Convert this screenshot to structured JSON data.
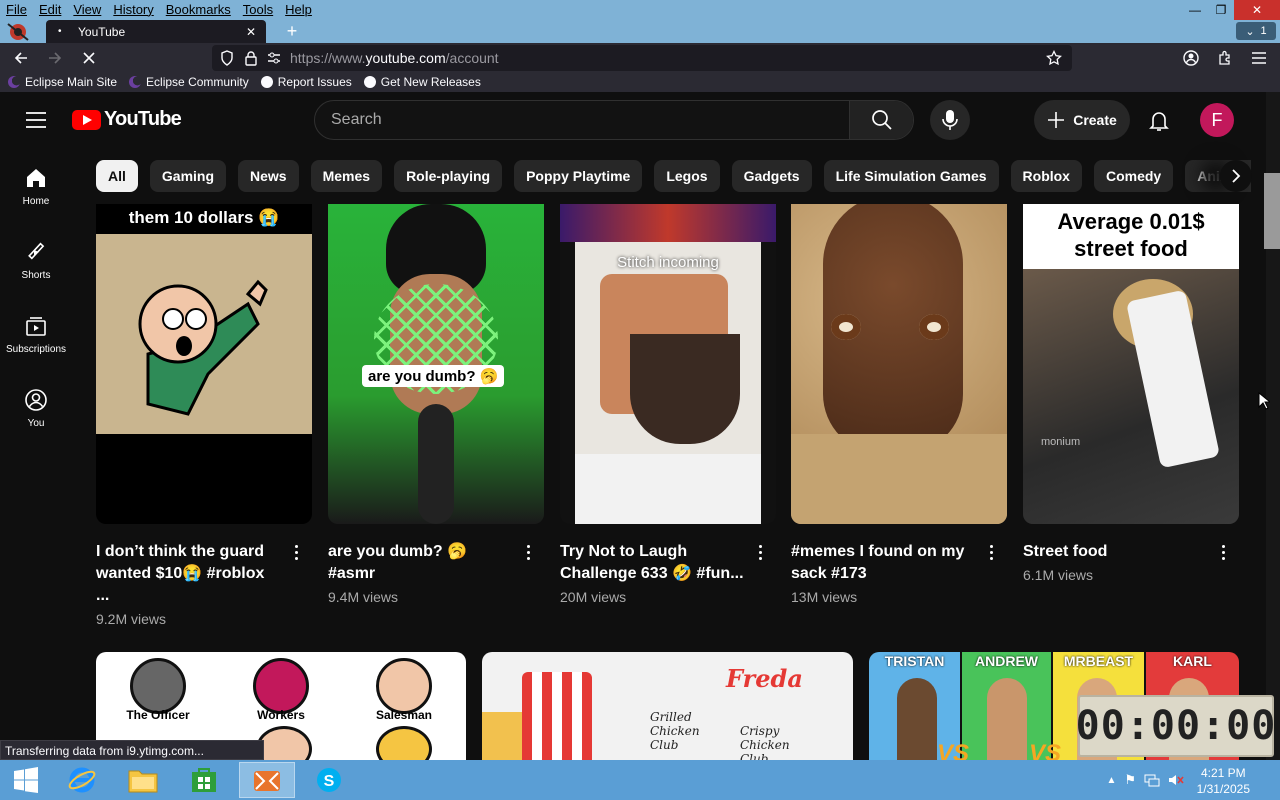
{
  "browser": {
    "menu": [
      "File",
      "Edit",
      "View",
      "History",
      "Bookmarks",
      "Tools",
      "Help"
    ],
    "tab_title": "YouTube",
    "tab_count": "1",
    "url_prefix": "https://www.",
    "url_host": "youtube.com",
    "url_path": "/account",
    "bookmarks": [
      "Eclipse Main Site",
      "Eclipse Community",
      "Report Issues",
      "Get New Releases"
    ],
    "status": "Transferring data from i9.ytimg.com..."
  },
  "youtube": {
    "logo_text": "YouTube",
    "search_placeholder": "Search",
    "create_label": "Create",
    "avatar_letter": "F",
    "sidebar": [
      {
        "label": "Home",
        "icon": "home-icon"
      },
      {
        "label": "Shorts",
        "icon": "shorts-icon"
      },
      {
        "label": "Subscriptions",
        "icon": "subscriptions-icon"
      },
      {
        "label": "You",
        "icon": "you-icon"
      }
    ],
    "chips": [
      "All",
      "Gaming",
      "News",
      "Memes",
      "Role-playing",
      "Poppy Playtime",
      "Legos",
      "Gadgets",
      "Life Simulation Games",
      "Roblox",
      "Comedy",
      "Animated f"
    ],
    "shorts": [
      {
        "title": "I don’t think the guard wanted $10😭 #roblox ...",
        "views": "9.2M views",
        "caption": "them 10 dollars 😭"
      },
      {
        "title": "are you dumb? 🥱 #asmr",
        "views": "9.4M views",
        "caption": "are you dumb? 🥱"
      },
      {
        "title": "Try Not to Laugh Challenge 633 🤣 #fun...",
        "views": "20M views",
        "caption": "Stitch incoming"
      },
      {
        "title": "#memes I found on my sack #173",
        "views": "13M views",
        "caption": ""
      },
      {
        "title": "Street food",
        "views": "6.1M views",
        "caption": "Average 0.01$ street food",
        "watermark": "monium"
      }
    ],
    "bottom_thumbs": {
      "first": [
        "The Officer",
        "Workers",
        "Salesman"
      ],
      "second": [
        "Freda",
        "Grilled Chicken Club",
        "Crispy Chicken Club"
      ],
      "third": [
        "TRISTAN",
        "ANDREW",
        "MRBEAST",
        "KARL"
      ],
      "vs": "VS"
    },
    "timer": "00:00:00"
  },
  "taskbar": {
    "time": "4:21 PM",
    "date": "1/31/2025"
  },
  "colors": {
    "accent": "#ff0000",
    "avatar": "#c2185b",
    "taskbar": "#5a9ed5"
  }
}
